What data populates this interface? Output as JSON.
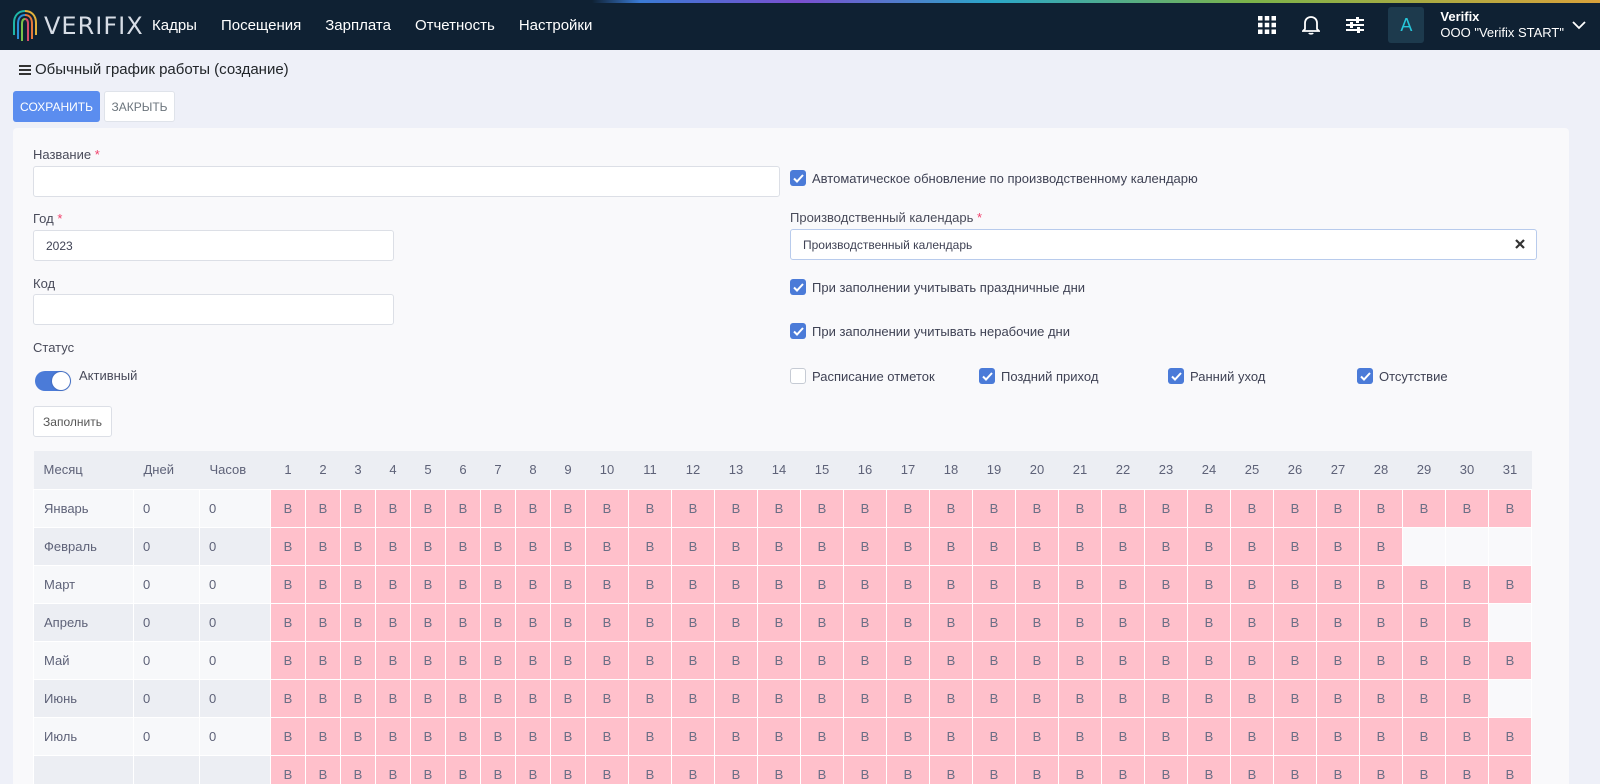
{
  "app": {
    "logo_text": "VERIFIX"
  },
  "nav": [
    "Кадры",
    "Посещения",
    "Зарплата",
    "Отчетность",
    "Настройки"
  ],
  "user": {
    "avatar_letter": "A",
    "name": "Verifix",
    "org": "ООО \"Verifix START\""
  },
  "page": {
    "title": "Обычный график работы (создание)"
  },
  "toolbar": {
    "save_label": "СОХРАНИТЬ",
    "close_label": "ЗАКРЫТЬ"
  },
  "form": {
    "name_label": "Название",
    "name_value": "",
    "year_label": "Год",
    "year_value": "2023",
    "code_label": "Код",
    "code_value": "",
    "status_label": "Статус",
    "status_value": "Активный",
    "auto_update_label": "Автоматическое обновление по производственному календарю",
    "calendar_label": "Производственный календарь",
    "calendar_value": "Производственный календарь",
    "holidays_label": "При заполнении учитывать праздничные дни",
    "nonwork_label": "При заполнении учитывать нерабочие дни",
    "marks_label": "Расписание отметок",
    "late_label": "Поздний приход",
    "early_label": "Ранний уход",
    "absence_label": "Отсутствие",
    "fill_label": "Заполнить",
    "required_mark": "*"
  },
  "checks": {
    "auto_update": true,
    "holidays": true,
    "nonwork": true,
    "marks": false,
    "late": true,
    "early": true,
    "absence": true
  },
  "table": {
    "headers": {
      "month": "Месяц",
      "days": "Дней",
      "hours": "Часов"
    },
    "day_columns": [
      "1",
      "2",
      "3",
      "4",
      "5",
      "6",
      "7",
      "8",
      "9",
      "10",
      "11",
      "12",
      "13",
      "14",
      "15",
      "16",
      "17",
      "18",
      "19",
      "20",
      "21",
      "22",
      "23",
      "24",
      "25",
      "26",
      "27",
      "28",
      "29",
      "30",
      "31"
    ],
    "rows": [
      {
        "month": "Январь",
        "days": "0",
        "hours": "0",
        "count": 31
      },
      {
        "month": "Февраль",
        "days": "0",
        "hours": "0",
        "count": 28
      },
      {
        "month": "Март",
        "days": "0",
        "hours": "0",
        "count": 31
      },
      {
        "month": "Апрель",
        "days": "0",
        "hours": "0",
        "count": 30
      },
      {
        "month": "Май",
        "days": "0",
        "hours": "0",
        "count": 31
      },
      {
        "month": "Июнь",
        "days": "0",
        "hours": "0",
        "count": 30
      },
      {
        "month": "Июль",
        "days": "0",
        "hours": "0",
        "count": 31
      },
      {
        "month": "",
        "days": "",
        "hours": "",
        "count": 31
      }
    ],
    "day_mark": "В"
  },
  "colors": {
    "primary": "#5b8def",
    "topbar": "#0f2133",
    "dayoff": "#ffc0cb"
  }
}
